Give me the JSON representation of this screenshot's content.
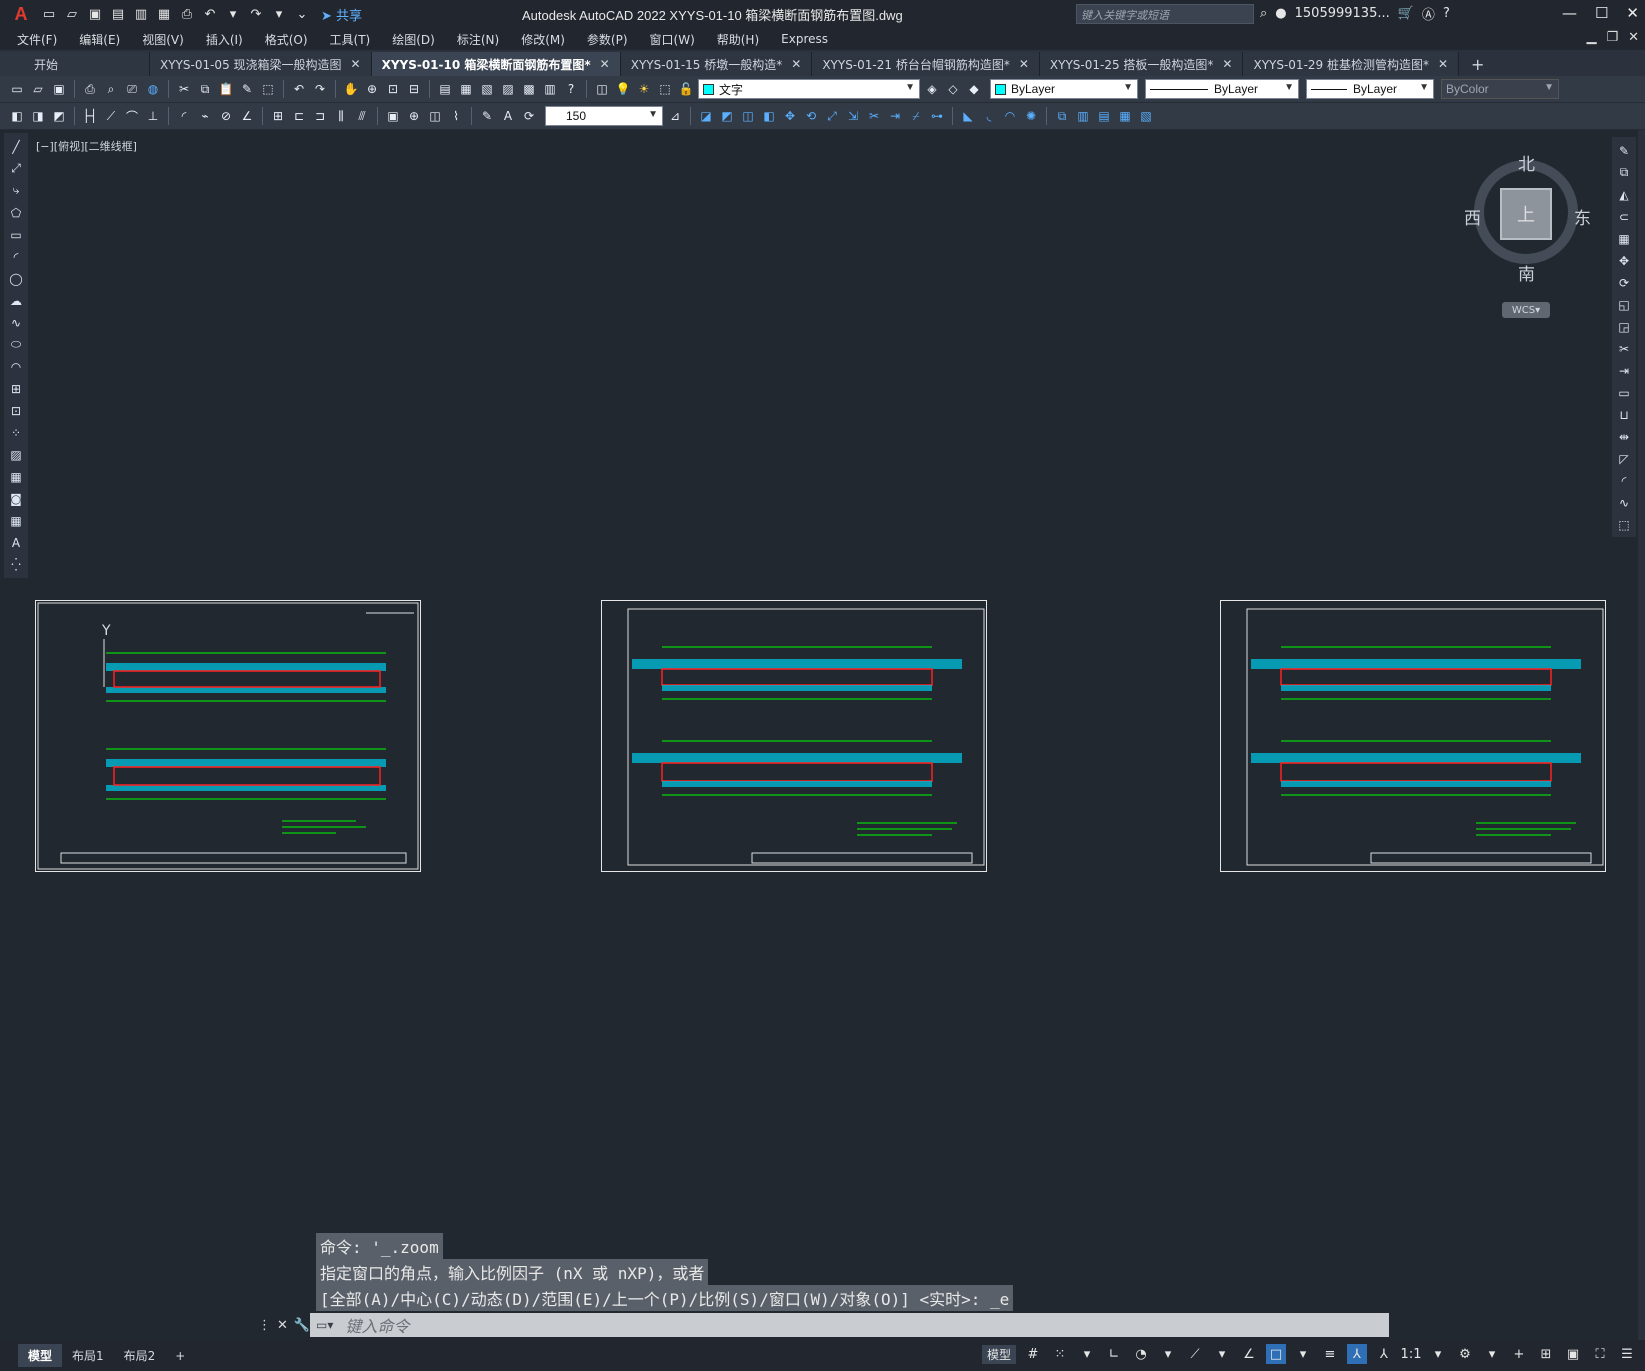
{
  "app": {
    "logo": "A",
    "title": "Autodesk AutoCAD 2022   XYYS-01-10 箱梁横断面钢筋布置图.dwg",
    "share_label": "共享",
    "search_placeholder": "键入关键字或短语",
    "user": "1505999135...",
    "help": "?"
  },
  "menu": [
    "文件(F)",
    "编辑(E)",
    "视图(V)",
    "插入(I)",
    "格式(O)",
    "工具(T)",
    "绘图(D)",
    "标注(N)",
    "修改(M)",
    "参数(P)",
    "窗口(W)",
    "帮助(H)",
    "Express"
  ],
  "tabs": [
    {
      "label": "开始",
      "active": false,
      "close": ""
    },
    {
      "label": "XYYS-01-05 现浇箱梁一般构造图",
      "active": false,
      "close": "✕"
    },
    {
      "label": "XYYS-01-10 箱梁横断面钢筋布置图*",
      "active": true,
      "close": "✕"
    },
    {
      "label": "XYYS-01-15 桥墩一般构造*",
      "active": false,
      "close": "✕"
    },
    {
      "label": "XYYS-01-21 桥台台帽钢筋构造图*",
      "active": false,
      "close": "✕"
    },
    {
      "label": "XYYS-01-25 搭板一般构造图*",
      "active": false,
      "close": "✕"
    },
    {
      "label": "XYYS-01-29 桩基检测管构造图*",
      "active": false,
      "close": "✕"
    }
  ],
  "toolbar": {
    "layer": "文字",
    "color": "ByLayer",
    "linetype": "ByLayer",
    "lineweight": "ByLayer",
    "plotstyle": "ByColor",
    "dimscale": "150",
    "layer_swatch": "#00ffff",
    "color_swatch": "#00ffff"
  },
  "viewport": {
    "label": "[−][俯视][二维线框]",
    "axis_y": "Y"
  },
  "viewcube": {
    "north": "北",
    "south": "南",
    "east": "东",
    "west": "西",
    "face": "上",
    "wcs": "WCS"
  },
  "command": {
    "history": [
      "命令: '_.zoom",
      "指定窗口的角点，输入比例因子 (nX 或 nXP)，或者",
      "[全部(A)/中心(C)/动态(D)/范围(E)/上一个(P)/比例(S)/窗口(W)/对象(O)] <实时>: _e"
    ],
    "placeholder": "键入命令"
  },
  "status": {
    "layouts": [
      "模型",
      "布局1",
      "布局2"
    ],
    "model": "模型",
    "scale": "1:1"
  },
  "colors": {
    "background": "#212830",
    "rebar_cyan": "#00e5ff",
    "dim_green": "#00ff00",
    "section_red": "#ff2020"
  }
}
